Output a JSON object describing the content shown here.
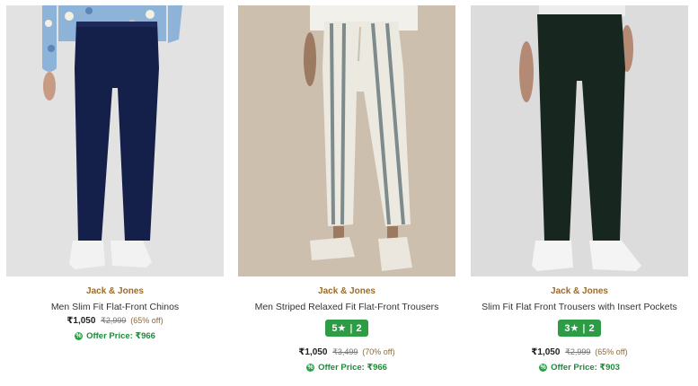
{
  "products": [
    {
      "brand": "Jack & Jones",
      "title": "Men Slim Fit Flat-Front Chinos",
      "price": "₹1,050",
      "mrp": "₹2,999",
      "discount": "(65% off)",
      "offer_label": "Offer Price: ₹966",
      "image_alt": "navy chinos",
      "colors": {
        "shirt": "#8db3d8",
        "pants": "#14204a",
        "shoes": "#f2f2f2"
      }
    },
    {
      "brand": "Jack & Jones",
      "title": "Men Striped Relaxed Fit Flat-Front Trousers",
      "rating": "5★",
      "rating_count": "2",
      "price": "₹1,050",
      "mrp": "₹3,499",
      "discount": "(70% off)",
      "offer_label": "Offer Price: ₹966",
      "image_alt": "striped trousers",
      "colors": {
        "shirt": "#f2f0ea",
        "pants": "#ece9e0",
        "stripe": "#7d8b8c",
        "shoes": "#ebe6de"
      }
    },
    {
      "brand": "Jack & Jones",
      "title": "Slim Fit Flat Front Trousers with Insert Pockets",
      "rating": "3★",
      "rating_count": "2",
      "price": "₹1,050",
      "mrp": "₹2,999",
      "discount": "(65% off)",
      "offer_label": "Offer Price: ₹903",
      "image_alt": "dark green trousers",
      "colors": {
        "shirt": "#ededed",
        "pants": "#17261f",
        "shoes": "#f4f4f4"
      }
    }
  ]
}
